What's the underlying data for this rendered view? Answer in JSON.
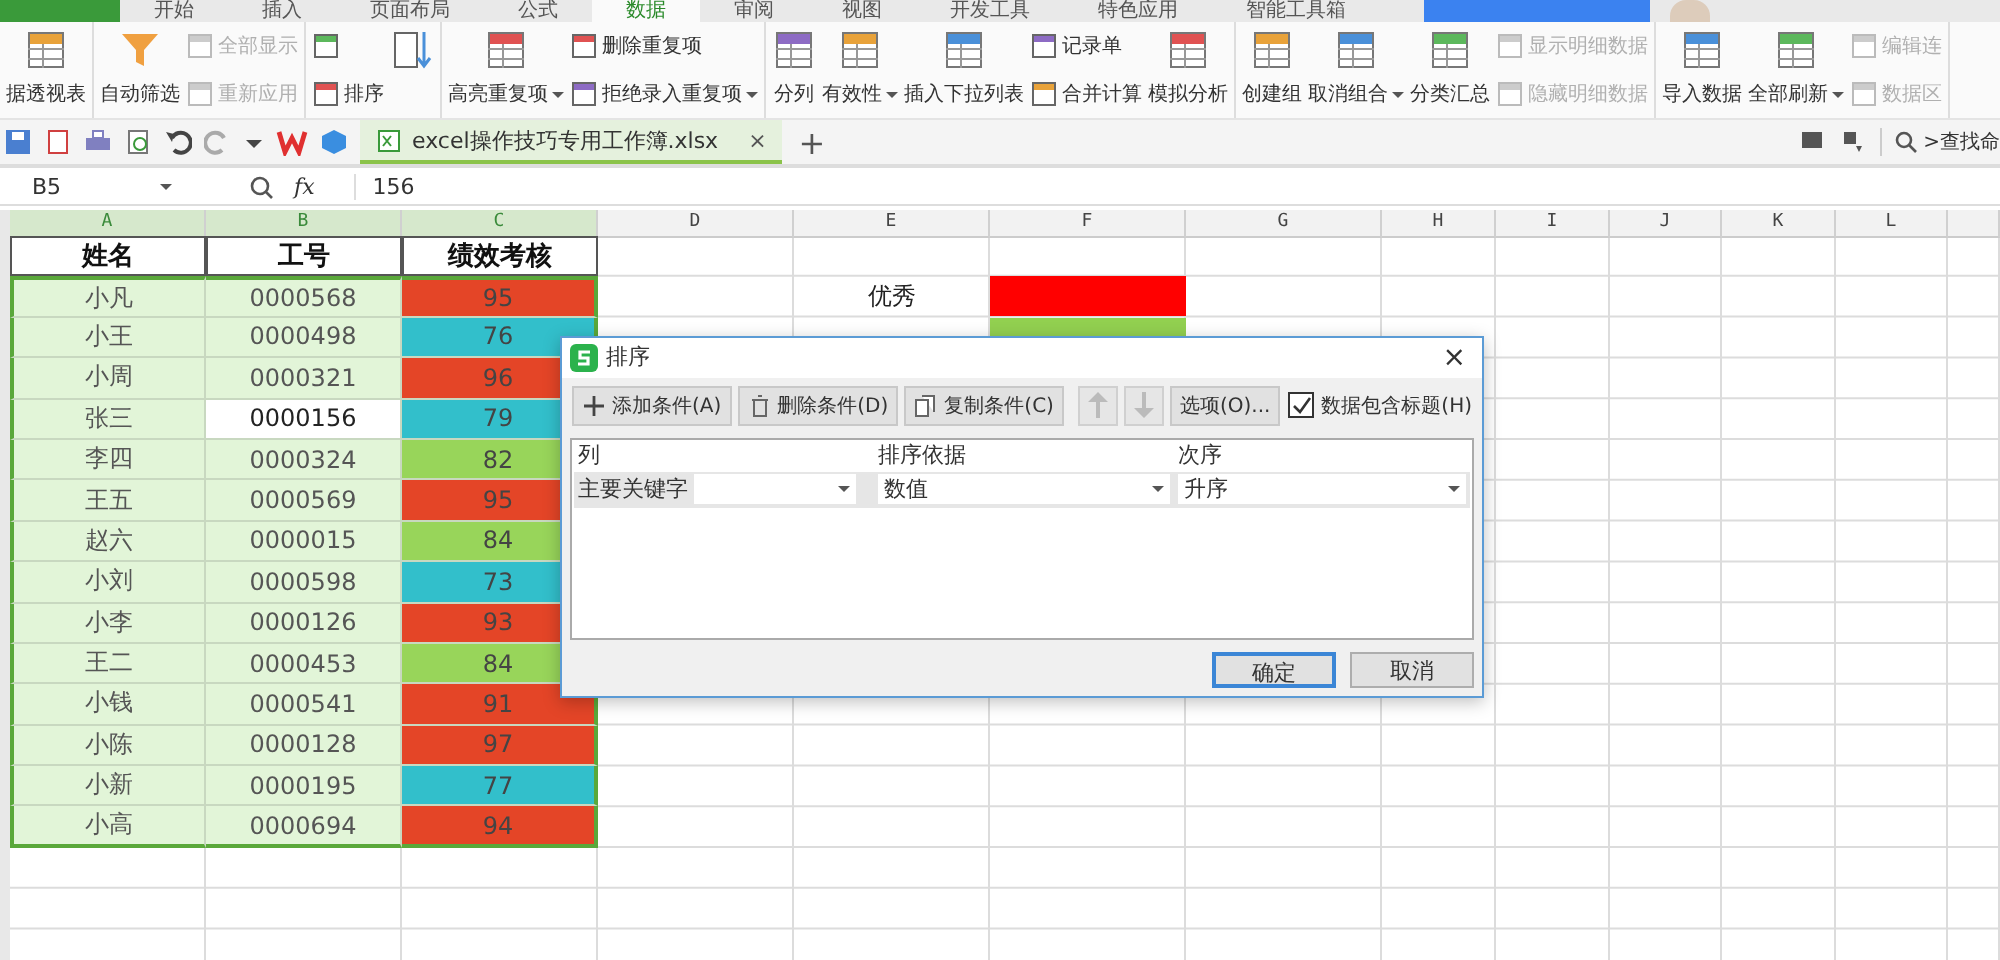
{
  "menu_tabs": [
    {
      "label": "开始",
      "selected": false
    },
    {
      "label": "插入",
      "selected": false
    },
    {
      "label": "页面布局",
      "selected": false
    },
    {
      "label": "公式",
      "selected": false
    },
    {
      "label": "数据",
      "selected": true
    },
    {
      "label": "审阅",
      "selected": false
    },
    {
      "label": "视图",
      "selected": false
    },
    {
      "label": "开发工具",
      "selected": false
    },
    {
      "label": "特色应用",
      "selected": false
    },
    {
      "label": "智能工具箱",
      "selected": false
    }
  ],
  "ribbon": {
    "groups": [
      {
        "columns": [
          {
            "kind": "large",
            "label": "据透视表"
          }
        ]
      },
      {
        "columns": [
          {
            "kind": "large",
            "label": "自动筛选"
          },
          {
            "kind": "stack",
            "items": [
              {
                "label": "全部显示",
                "disabled": true
              },
              {
                "label": "重新应用",
                "disabled": true
              }
            ]
          }
        ]
      },
      {
        "columns": [
          {
            "kind": "stack",
            "items": [
              {
                "disabled": false
              },
              {
                "label": "排序",
                "disabled": false
              }
            ]
          },
          {
            "kind": "large"
          }
        ]
      },
      {
        "columns": [
          {
            "kind": "large",
            "label": "高亮重复项",
            "dropdown": true
          },
          {
            "kind": "stack",
            "items": [
              {
                "label": "删除重复项",
                "disabled": false
              },
              {
                "label": "拒绝录入重复项",
                "disabled": false,
                "dropdown": true
              }
            ]
          }
        ]
      },
      {
        "columns": [
          {
            "kind": "large",
            "label": "分列"
          },
          {
            "kind": "large",
            "label": "有效性",
            "dropdown": true
          },
          {
            "kind": "large",
            "label": "插入下拉列表"
          },
          {
            "kind": "stack",
            "items": [
              {
                "label": "记录单",
                "disabled": false
              },
              {
                "label": "合并计算",
                "disabled": false
              }
            ]
          },
          {
            "kind": "large",
            "label": "模拟分析"
          }
        ]
      },
      {
        "columns": [
          {
            "kind": "large",
            "label": "创建组"
          },
          {
            "kind": "large",
            "label": "取消组合",
            "dropdown": true
          },
          {
            "kind": "large",
            "label": "分类汇总"
          },
          {
            "kind": "stack",
            "items": [
              {
                "label": "显示明细数据",
                "disabled": true
              },
              {
                "label": "隐藏明细数据",
                "disabled": true
              }
            ]
          }
        ]
      },
      {
        "columns": [
          {
            "kind": "large",
            "label": "导入数据"
          },
          {
            "kind": "large",
            "label": "全部刷新",
            "dropdown": true
          },
          {
            "kind": "stack",
            "items": [
              {
                "label": "编辑连",
                "disabled": true
              },
              {
                "label": "数据区",
                "disabled": true
              }
            ]
          }
        ]
      }
    ]
  },
  "document_tab": {
    "title": "excel操作技巧专用工作簿.xlsx",
    "close": "×",
    "new": "+"
  },
  "command_search": {
    "placeholder": ">查找命"
  },
  "formula_bar": {
    "cell": "B5",
    "fx": "fx",
    "value": "156"
  },
  "columns": [
    {
      "label": "A",
      "selected": true
    },
    {
      "label": "B",
      "selected": true
    },
    {
      "label": "C",
      "selected": true
    },
    {
      "label": "D",
      "selected": false
    },
    {
      "label": "E",
      "selected": false
    },
    {
      "label": "F",
      "selected": false
    },
    {
      "label": "G",
      "selected": false
    },
    {
      "label": "H",
      "selected": false
    },
    {
      "label": "I",
      "selected": false
    },
    {
      "label": "J",
      "selected": false
    },
    {
      "label": "K",
      "selected": false
    },
    {
      "label": "L",
      "selected": false
    }
  ],
  "table": {
    "headers": [
      "姓名",
      "工号",
      "绩效考核"
    ],
    "rows": [
      {
        "name": "小凡",
        "id": "0000568",
        "score": "95",
        "color": "#e44527",
        "selected": false
      },
      {
        "name": "小王",
        "id": "0000498",
        "score": "76",
        "color": "#32bfcb",
        "selected": false
      },
      {
        "name": "小周",
        "id": "0000321",
        "score": "96",
        "color": "#e44527",
        "selected": false
      },
      {
        "name": "张三",
        "id": "0000156",
        "score": "79",
        "color": "#32bfcb",
        "selected": true
      },
      {
        "name": "李四",
        "id": "0000324",
        "score": "82",
        "color": "#98d55a",
        "selected": false
      },
      {
        "name": "王五",
        "id": "0000569",
        "score": "95",
        "color": "#e44527",
        "selected": false
      },
      {
        "name": "赵六",
        "id": "0000015",
        "score": "84",
        "color": "#98d55a",
        "selected": false
      },
      {
        "name": "小刘",
        "id": "0000598",
        "score": "73",
        "color": "#32bfcb",
        "selected": false
      },
      {
        "name": "小李",
        "id": "0000126",
        "score": "93",
        "color": "#e44527",
        "selected": false
      },
      {
        "name": "王二",
        "id": "0000453",
        "score": "84",
        "color": "#98d55a",
        "selected": false
      },
      {
        "name": "小钱",
        "id": "0000541",
        "score": "91",
        "color": "#e44527",
        "selected": false
      },
      {
        "name": "小陈",
        "id": "0000128",
        "score": "97",
        "color": "#e44527",
        "selected": false
      },
      {
        "name": "小新",
        "id": "0000195",
        "score": "77",
        "color": "#32bfcb",
        "selected": false
      },
      {
        "name": "小高",
        "id": "0000694",
        "score": "94",
        "color": "#e44527",
        "selected": false
      }
    ]
  },
  "legend": [
    {
      "label": "优秀",
      "color": "#ff0000"
    },
    {
      "color": "#92d050"
    }
  ],
  "sort_dialog": {
    "title": "排序",
    "close": "×",
    "toolbar": [
      {
        "kind": "button",
        "label": "添加条件(A)",
        "disabled": false
      },
      {
        "kind": "button",
        "label": "删除条件(D)",
        "disabled": false
      },
      {
        "kind": "button",
        "label": "复制条件(C)",
        "disabled": false
      },
      {
        "kind": "up",
        "disabled": true
      },
      {
        "kind": "down",
        "disabled": true
      },
      {
        "kind": "button",
        "label": "选项(O)...",
        "disabled": false
      }
    ],
    "header_checkbox": {
      "label": "数据包含标题(H)",
      "checked": true
    },
    "columns": [
      "列",
      "排序依据",
      "次序"
    ],
    "rows": [
      {
        "label": "主要关键字",
        "basis": "数值",
        "order": "升序"
      }
    ],
    "buttons": [
      {
        "label": "确定",
        "selected": true
      },
      {
        "label": "取消",
        "selected": false
      }
    ]
  }
}
